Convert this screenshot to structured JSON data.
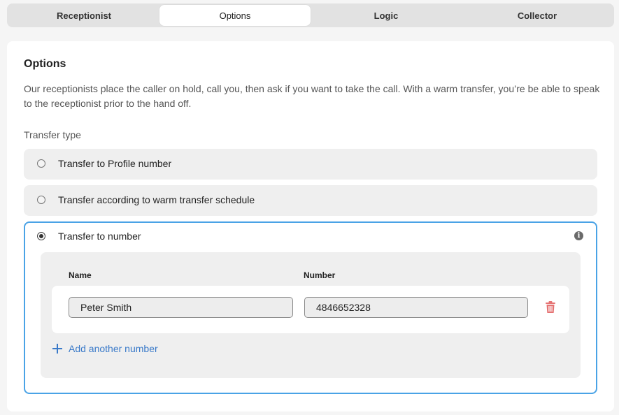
{
  "tabs": [
    {
      "label": "Receptionist",
      "active": false
    },
    {
      "label": "Options",
      "active": true
    },
    {
      "label": "Logic",
      "active": false
    },
    {
      "label": "Collector",
      "active": false
    }
  ],
  "options": {
    "title": "Options",
    "description": "Our receptionists place the caller on hold, call you, then ask if you want to take the call. With a warm transfer, you’re be able to speak to the receptionist prior to the hand off.",
    "transfer_type_label": "Transfer type",
    "transfer_options": [
      {
        "label": "Transfer to Profile number",
        "selected": false
      },
      {
        "label": "Transfer according to warm transfer schedule",
        "selected": false
      },
      {
        "label": "Transfer to number",
        "selected": true
      }
    ],
    "numbers_table": {
      "name_header": "Name",
      "number_header": "Number",
      "rows": [
        {
          "name": "Peter Smith",
          "number": "4846652328"
        }
      ],
      "add_label": "Add another number"
    }
  },
  "icons": {
    "info": "info-icon",
    "delete": "trash-icon",
    "add": "plus-icon"
  },
  "colors": {
    "selected_border": "#4aa3e6",
    "link": "#3a7ac9",
    "delete": "#e57373"
  }
}
